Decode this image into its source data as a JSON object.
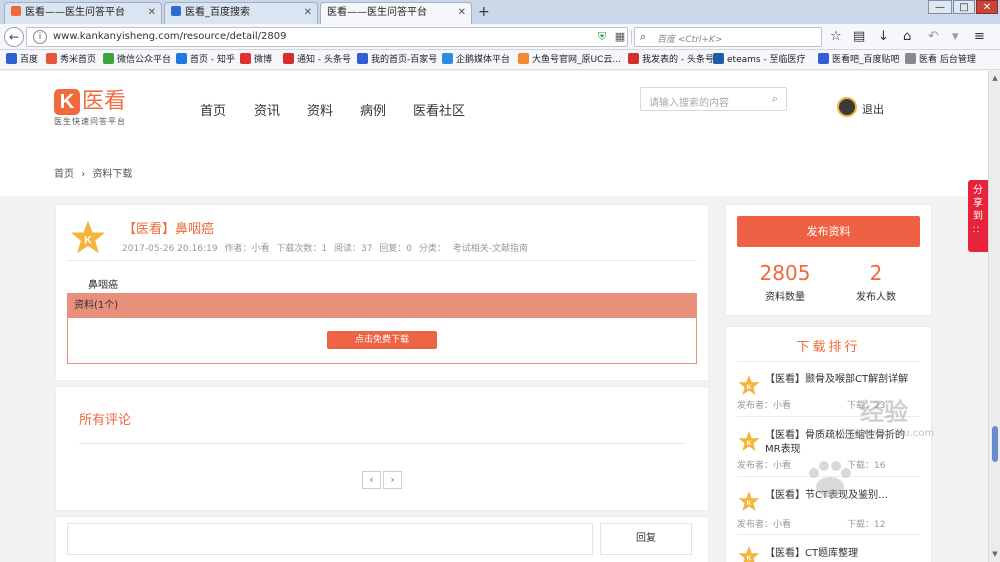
{
  "browser": {
    "tabs": [
      {
        "title": "医看——医生问答平台"
      },
      {
        "title": "医看_百度搜索"
      },
      {
        "title": "医看——医生问答平台"
      }
    ],
    "new_tab": "+",
    "window_controls": {
      "minimize": "—",
      "maximize": "□",
      "close": "✕"
    },
    "url": "www.kankanyisheng.com/resource/detail/2809",
    "search_placeholder": "百度 <Ctrl+K>",
    "bookmarks": [
      {
        "label": "百度",
        "color": "#2f5fd0"
      },
      {
        "label": "秀米首页",
        "color": "#e5563a"
      },
      {
        "label": "微信公众平台",
        "color": "#3aa43c"
      },
      {
        "label": "首页 - 知乎",
        "color": "#1e78e0"
      },
      {
        "label": "微博",
        "color": "#e0322c"
      },
      {
        "label": "通知 - 头条号",
        "color": "#d62c2c"
      },
      {
        "label": "我的首页-百家号",
        "color": "#2f5fd0"
      },
      {
        "label": "企鹅媒体平台",
        "color": "#2b8de0"
      },
      {
        "label": "大鱼号官网_原UC云...",
        "color": "#f08a2a"
      },
      {
        "label": "我发表的 - 头条号",
        "color": "#d62c2c"
      },
      {
        "label": "eteams - 至临医疗",
        "color": "#1f5aa8"
      },
      {
        "label": "医看吧_百度贴吧",
        "color": "#2f5fd0"
      },
      {
        "label": "医看 后台管理",
        "color": "#888888"
      }
    ]
  },
  "site": {
    "logo_mark": "K",
    "logo_name": "医看",
    "logo_slogan": "医生快速问答平台",
    "nav": [
      "首页",
      "资讯",
      "资料",
      "病例",
      "医看社区"
    ],
    "search_placeholder": "请输入搜索的内容",
    "logout": "退出",
    "share_tab": "分享到",
    "share_dots": "：："
  },
  "breadcrumb": {
    "home": "首页",
    "sep": "›",
    "current": "资料下载"
  },
  "resource": {
    "title": "【医看】鼻咽癌",
    "date": "2017-05-26 20:16:19",
    "author": "作者：小看",
    "downloads": "下载次数：1",
    "reads": "阅读：37",
    "replies": "回复：0",
    "category": "分类：",
    "category_value": "考试相关-文献指南",
    "tag": "鼻咽癌",
    "attach_header": "资料(1个)",
    "download_button": "点击免费下载"
  },
  "comments": {
    "title": "所有评论",
    "prev": "‹",
    "next": "›",
    "reply_button": "回复"
  },
  "sidebar": {
    "publish_button": "发布资料",
    "stats": [
      {
        "value": "2805",
        "label": "资料数量"
      },
      {
        "value": "2",
        "label": "发布人数"
      }
    ],
    "rank_title": "下载排行",
    "rank_items": [
      {
        "name": "【医看】颞骨及喉部CT解剖详解",
        "publisher": "发布者：小看",
        "downloads": "下载：23"
      },
      {
        "name": "【医看】骨质疏松压缩性骨折的MR表现",
        "publisher": "发布者：小看",
        "downloads": "下载：16"
      },
      {
        "name": "【医看】节CT表现及鉴别…",
        "publisher": "发布者：小看",
        "downloads": "下载：12"
      },
      {
        "name": "【医看】CT题库整理",
        "publisher": "",
        "downloads": ""
      }
    ]
  },
  "watermark": {
    "text": "经验",
    "sub": "jingyan.baidu.com"
  },
  "colors": {
    "accent": "#f06a3c",
    "button": "#ef6145",
    "attach_header": "#e8907b",
    "share_tab": "#e8243c"
  }
}
